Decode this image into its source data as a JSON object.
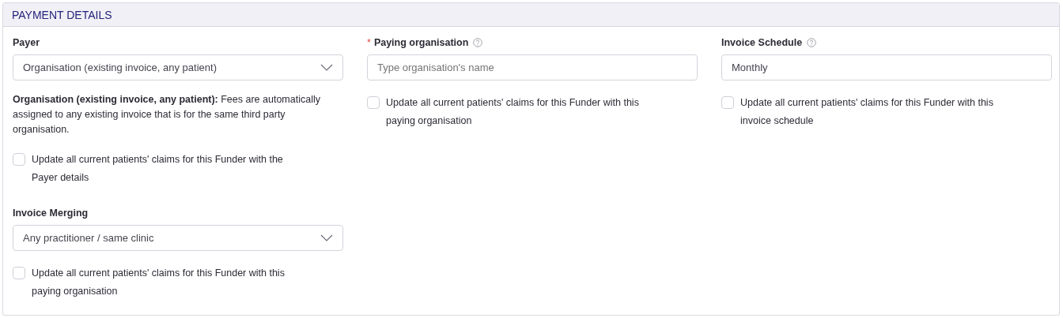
{
  "section": {
    "title": "PAYMENT DETAILS"
  },
  "columns": [
    {
      "fields": [
        {
          "label": "Payer",
          "help": false,
          "control": {
            "kind": "select",
            "value": "Organisation (existing invoice, any patient)"
          },
          "note": "**Organisation (existing invoice, any patient):** Fees are automatically assigned to any existing invoice that is for the same third party organisation.",
          "checkbox": {
            "label": "Update all current patients' claims for this Funder with the Payer details",
            "checked": false
          }
        },
        {
          "label": "Invoice Merging",
          "help": false,
          "control": {
            "kind": "select",
            "value": "Any practitioner / same clinic"
          },
          "checkbox": {
            "label": "Update all current patients' claims for this Funder with this paying organisation",
            "checked": false
          }
        }
      ]
    },
    {
      "fields": [
        {
          "required_mark": "*",
          "label": "Paying organisation",
          "help": true,
          "control": {
            "kind": "text",
            "placeholder": "Type organisation's name"
          },
          "checkbox": {
            "label": "Update all current patients' claims for this Funder with this paying organisation",
            "checked": false
          }
        }
      ]
    },
    {
      "fields": [
        {
          "label": "Invoice Schedule",
          "help": true,
          "control": {
            "kind": "text",
            "value": "Monthly"
          },
          "checkbox": {
            "label": "Update all current patients' claims for this Funder with this invoice schedule",
            "checked": false
          }
        }
      ]
    }
  ]
}
